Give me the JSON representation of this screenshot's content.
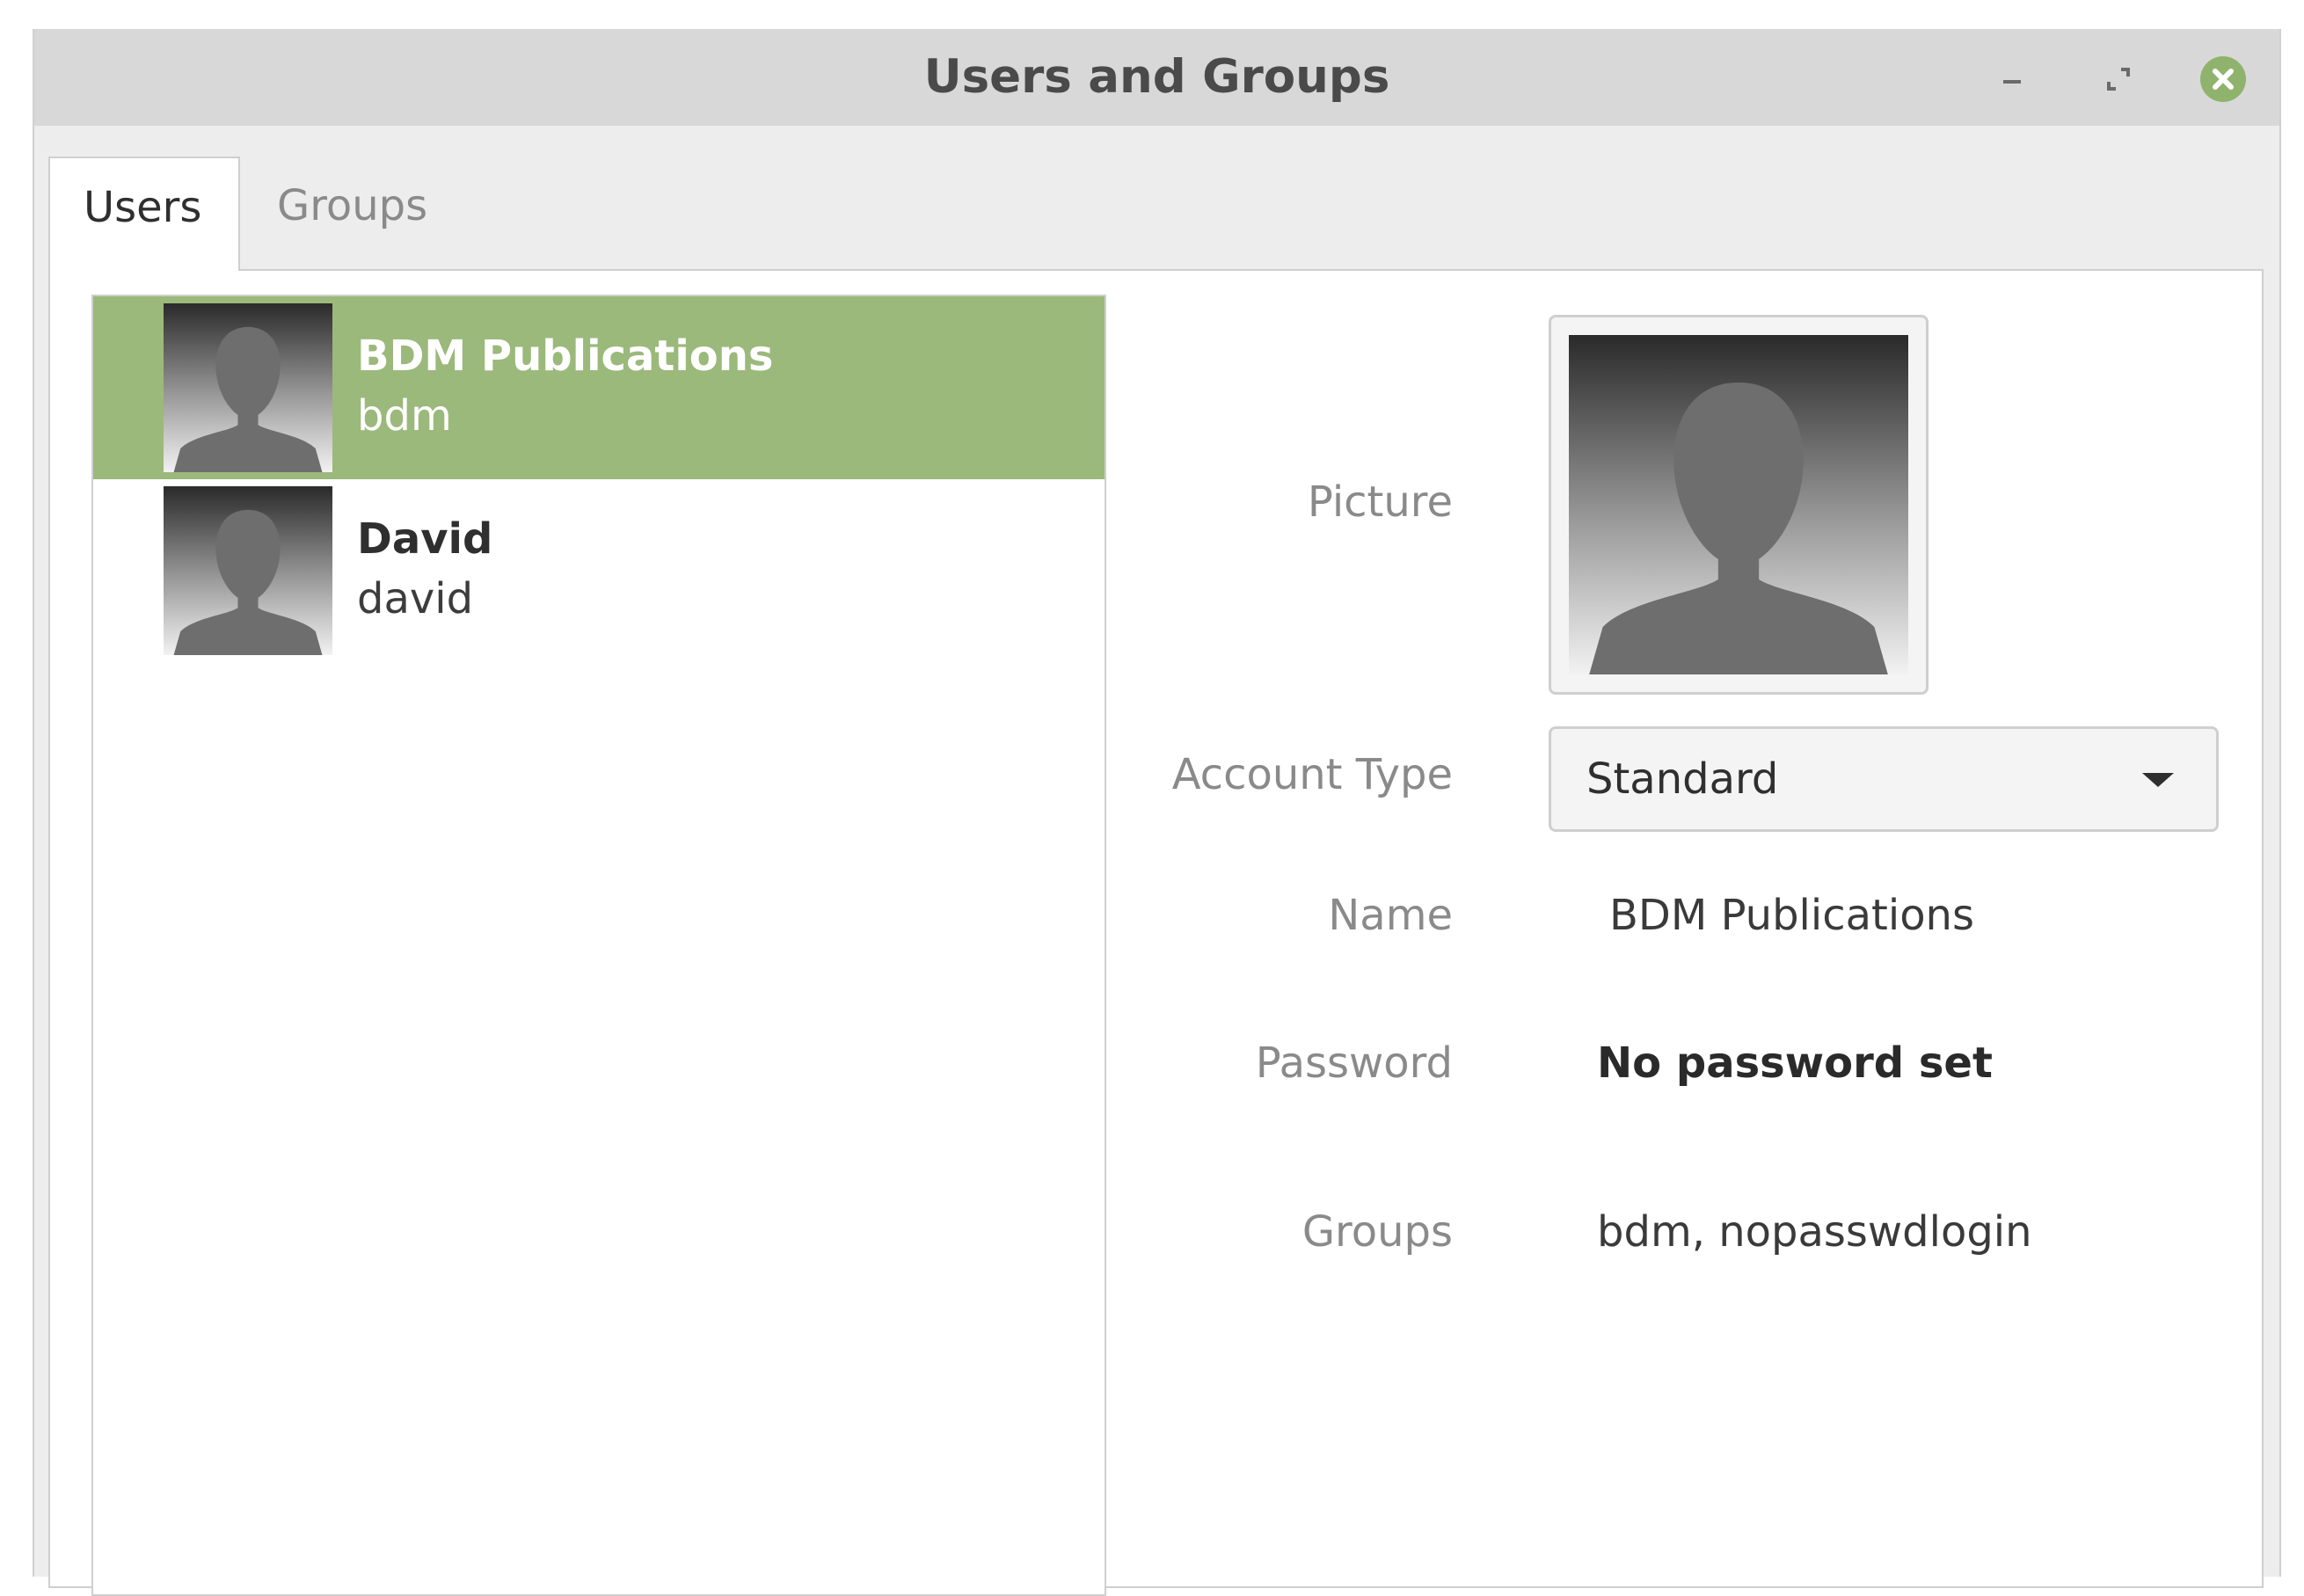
{
  "window": {
    "title": "Users and Groups",
    "controls": {
      "minimize": "minimize-icon",
      "maximize": "maximize-icon",
      "close": "close-icon"
    },
    "accent": "#8fb36d"
  },
  "tabs": [
    {
      "label": "Users",
      "active": true
    },
    {
      "label": "Groups",
      "active": false
    }
  ],
  "users": [
    {
      "name": "BDM Publications",
      "login": "bdm",
      "selected": true
    },
    {
      "name": "David",
      "login": "david",
      "selected": false
    }
  ],
  "details": {
    "picture_label": "Picture",
    "account_type_label": "Account Type",
    "account_type_value": "Standard",
    "name_label": "Name",
    "name_value": "BDM Publications",
    "password_label": "Password",
    "password_value": "No password set",
    "groups_label": "Groups",
    "groups_value": "bdm, nopasswdlogin"
  },
  "colors": {
    "selection": "#9bb97b",
    "titlebar": "#d8d8d8"
  }
}
